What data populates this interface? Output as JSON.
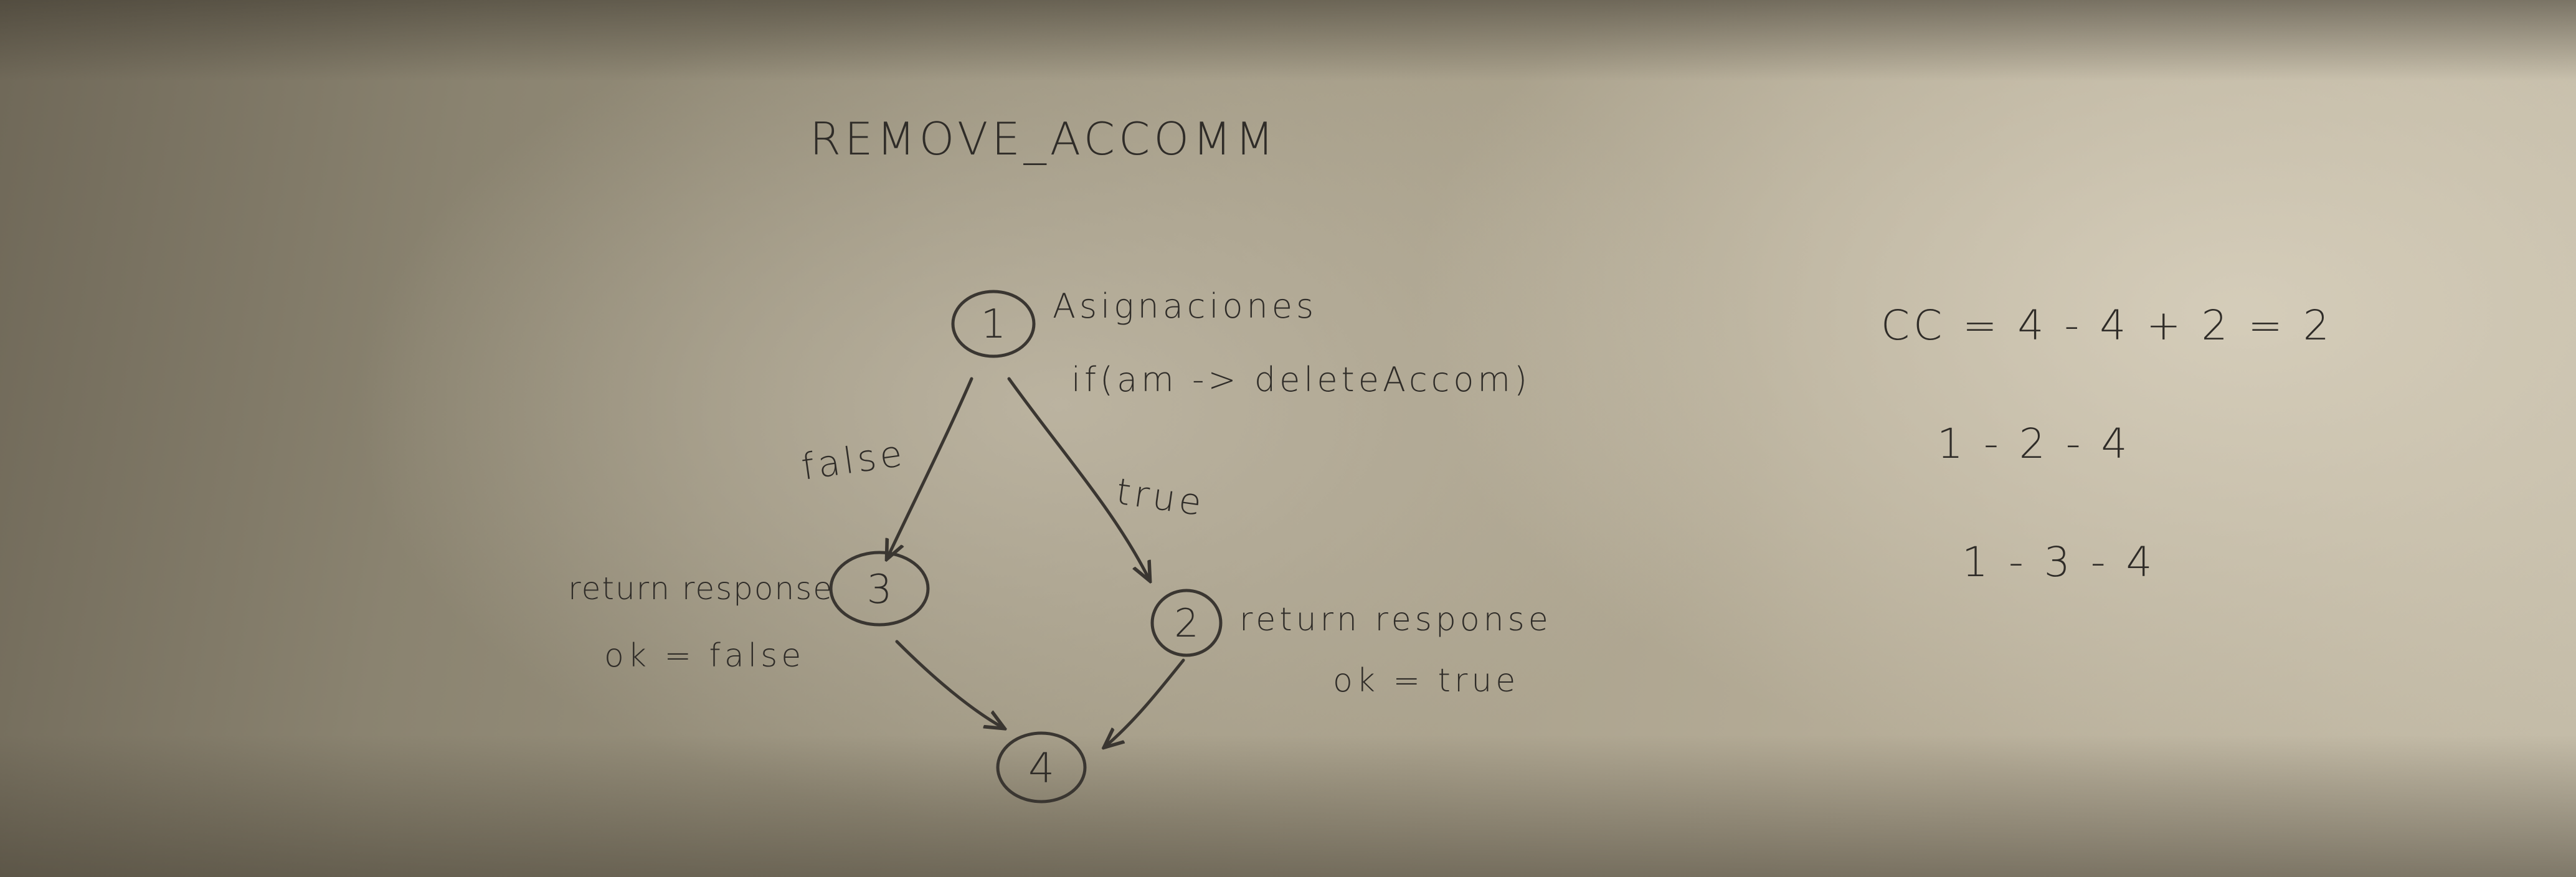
{
  "title": "REMOVE_ACCOMM",
  "nodes": [
    {
      "id": "1",
      "lines": [
        "Asignaciones",
        "if(am -> deleteAccom)"
      ]
    },
    {
      "id": "2",
      "lines": [
        "return response",
        "ok = true"
      ]
    },
    {
      "id": "3",
      "lines": [
        "return response",
        "ok = false"
      ]
    },
    {
      "id": "4",
      "lines": []
    }
  ],
  "edges": [
    {
      "from": "1",
      "to": "3",
      "label": "false"
    },
    {
      "from": "1",
      "to": "2",
      "label": "true"
    },
    {
      "from": "3",
      "to": "4",
      "label": ""
    },
    {
      "from": "2",
      "to": "4",
      "label": ""
    }
  ],
  "complexity": {
    "formula": "CC = 4 - 4 + 2 = 2",
    "paths": [
      "1 - 2 - 4",
      "1 - 3 - 4"
    ]
  },
  "colors": {
    "ink": "#2f2c28",
    "paper": "#b6ad98"
  }
}
